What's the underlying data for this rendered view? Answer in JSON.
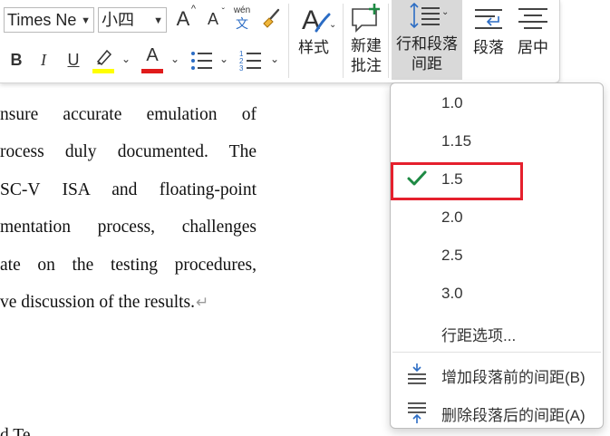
{
  "ribbon": {
    "font_name": "Times Ne",
    "font_size": "小四",
    "buttons": {
      "grow_font": "A",
      "shrink_font": "A",
      "pinyin_top": "wén",
      "pinyin_bottom": "文",
      "bold": "B",
      "italic": "I",
      "underline": "U",
      "font_color": "A",
      "styles_label": "样式",
      "new_comment_label_1": "新建",
      "new_comment_label_2": "批注",
      "line_spacing_label_1": "行和段落",
      "line_spacing_label_2": "间距",
      "paragraph_label": "段落",
      "center_label": "居中"
    }
  },
  "document": {
    "lines": [
      "nsure accurate emulation of",
      "rocess duly documented. The",
      "SC-V ISA and floating-point",
      "mentation process, challenges",
      "ate on the testing procedures,",
      "ve discussion of the results."
    ],
    "bottom_fragment": "d Te"
  },
  "line_spacing_menu": {
    "options": [
      "1.0",
      "1.15",
      "1.5",
      "2.0",
      "2.5",
      "3.0"
    ],
    "selected": "1.5",
    "more_options": "行距选项...",
    "add_space_before": "增加段落前的间距(B)",
    "remove_space_after": "删除段落后的间距(A)"
  },
  "colors": {
    "highlight_yellow": "#ffff00",
    "font_color_red": "#e01b1b",
    "check_green": "#1e8a44",
    "annotation_red": "#e5202d",
    "accent_blue": "#2b6cc4"
  }
}
